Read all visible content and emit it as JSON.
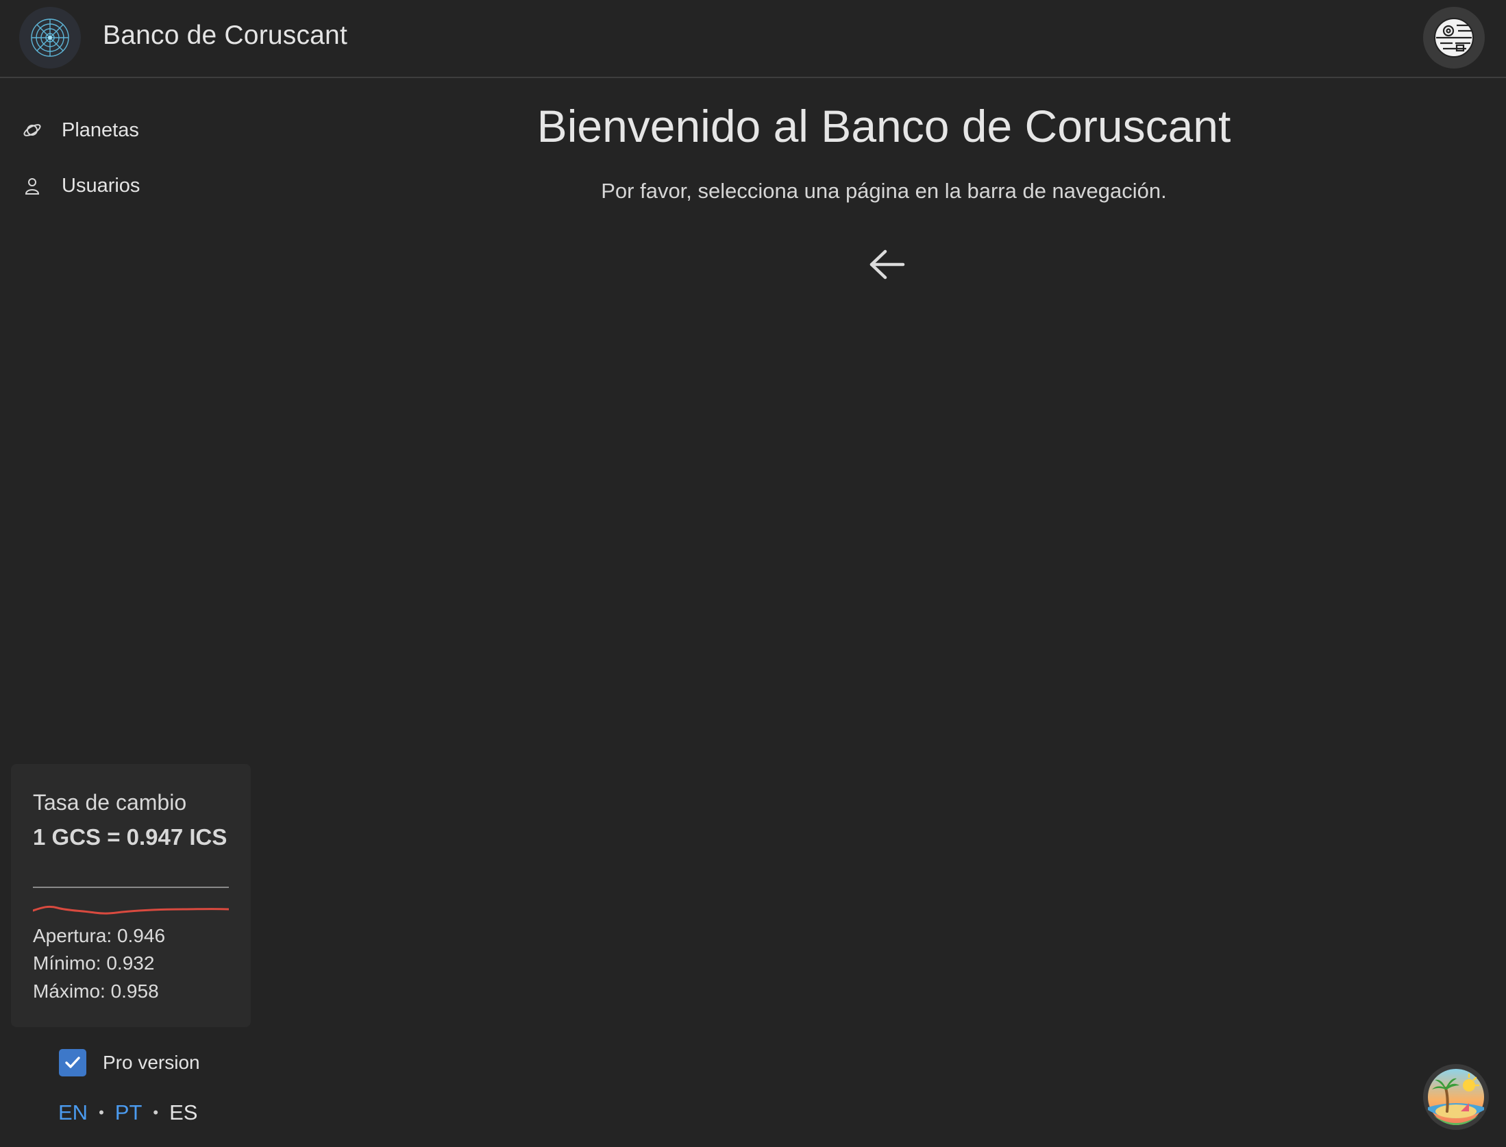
{
  "header": {
    "app_title": "Banco de Coruscant",
    "logo_icon": "spiderweb-logo-icon",
    "user_avatar_icon": "death-star-avatar-icon"
  },
  "sidebar": {
    "items": [
      {
        "label": "Planetas",
        "icon": "planet-icon"
      },
      {
        "label": "Usuarios",
        "icon": "user-icon"
      }
    ]
  },
  "exchange": {
    "title": "Tasa de cambio",
    "rate": "1 GCS = 0.947 ICS",
    "opening": "Apertura: 0.946",
    "minimum": "Mínimo: 0.932",
    "maximum": "Máximo: 0.958",
    "trend_color": "#d94a3f"
  },
  "pro": {
    "label": "Pro version",
    "checked": true
  },
  "languages": {
    "items": [
      "EN",
      "PT",
      "ES"
    ],
    "active": "ES",
    "link_color": "#4b9bef"
  },
  "main": {
    "title": "Bienvenido al Banco de Coruscant",
    "subtitle": "Por favor, selecciona una página en la barra de navegación.",
    "arrow_icon": "arrow-left-icon"
  },
  "theme_badge": {
    "icon": "tropical-island-icon"
  },
  "colors": {
    "background": "#242424",
    "card": "#2b2b2b",
    "accent": "#3d78c9"
  }
}
